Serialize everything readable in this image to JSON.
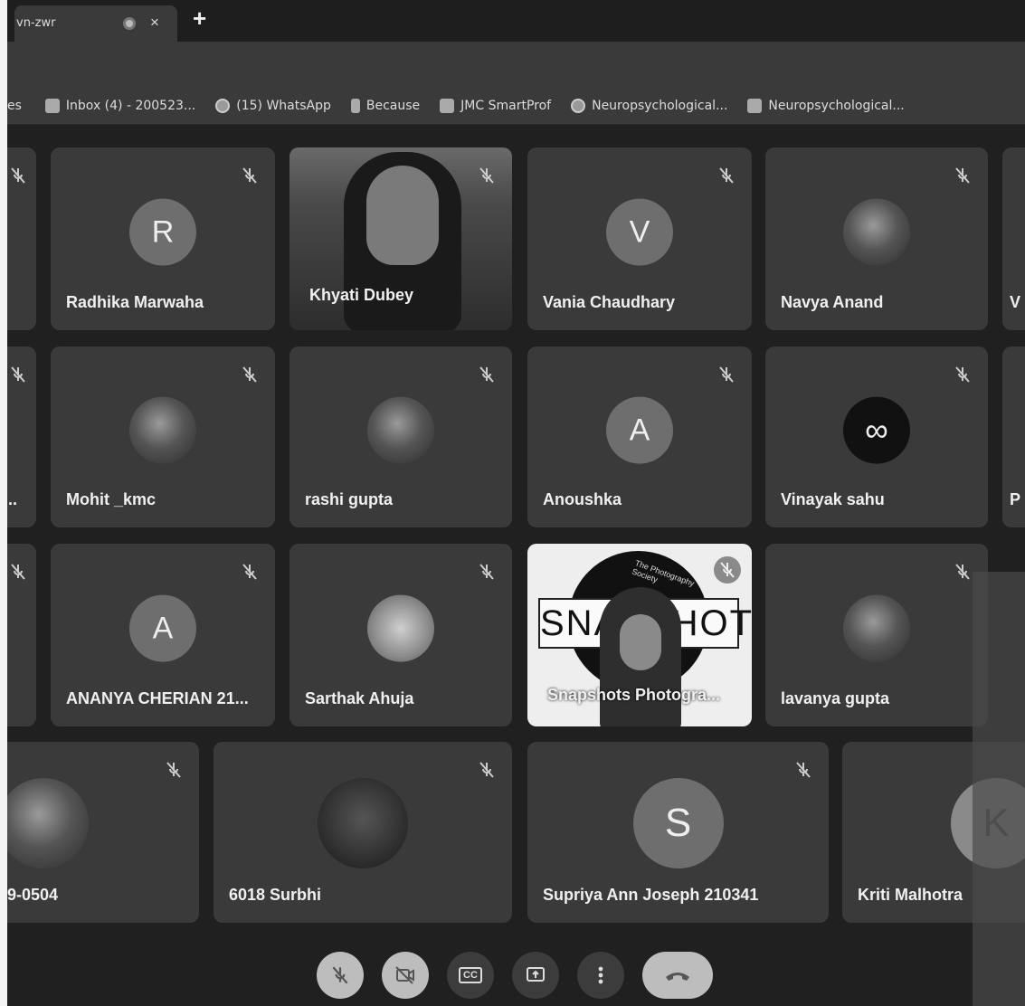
{
  "browser": {
    "tab_title": "vn-zwr",
    "tab_close": "×",
    "new_tab": "+",
    "bookmarks": [
      {
        "label": "es",
        "icon": "none"
      },
      {
        "label": "Inbox (4) - 200523...",
        "icon": "gmail-icon"
      },
      {
        "label": "(15) WhatsApp",
        "icon": "whatsapp-icon"
      },
      {
        "label": "Because",
        "icon": "bookmark-icon"
      },
      {
        "label": "JMC SmartProf",
        "icon": "smartprof-icon"
      },
      {
        "label": "Neuropsychological...",
        "icon": "link-icon"
      },
      {
        "label": "Neuropsychological...",
        "icon": "ios-icon"
      }
    ]
  },
  "tiles": [
    {
      "name": "Radhika Marwaha",
      "initial": "R",
      "kind": "initial"
    },
    {
      "name": "Khyati Dubey",
      "kind": "video"
    },
    {
      "name": "Vania Chaudhary",
      "initial": "V",
      "kind": "initial"
    },
    {
      "name": "Navya Anand",
      "kind": "photo"
    },
    {
      "name": "Mohit _kmc",
      "kind": "photo"
    },
    {
      "name": "rashi gupta",
      "kind": "photo"
    },
    {
      "name": "Anoushka",
      "initial": "A",
      "kind": "initial"
    },
    {
      "name": "Vinayak sahu",
      "initial": "∞",
      "kind": "infinity"
    },
    {
      "name": "ANANYA CHERIAN 21...",
      "initial": "A",
      "kind": "initial"
    },
    {
      "name": "Sarthak Ahuja",
      "kind": "photo"
    },
    {
      "name": "Snapshots Photogra...",
      "kind": "video-logo",
      "logo_text": "SNAPSHOTS",
      "logo_small": "The Photography Society"
    },
    {
      "name": "lavanya gupta",
      "kind": "photo"
    },
    {
      "name": "9-0504",
      "kind": "photo"
    },
    {
      "name": "6018 Surbhi",
      "kind": "photo"
    },
    {
      "name": "Supriya Ann Joseph 210341",
      "initial": "S",
      "kind": "initial"
    },
    {
      "name": "Kriti Malhotra",
      "initial": "K",
      "kind": "photo"
    }
  ],
  "edge_fragments": {
    "row2_left": "...",
    "row1_right": "V",
    "row2_right": "P"
  },
  "controls": [
    {
      "name": "microphone-off-button",
      "icon": "mic-off-icon"
    },
    {
      "name": "camera-off-button",
      "icon": "camera-off-icon"
    },
    {
      "name": "captions-button",
      "icon": "cc-icon",
      "label": "CC"
    },
    {
      "name": "present-button",
      "icon": "present-icon"
    },
    {
      "name": "more-options-button",
      "icon": "more-vert-icon"
    },
    {
      "name": "leave-call-button",
      "icon": "phone-hangup-icon"
    }
  ]
}
